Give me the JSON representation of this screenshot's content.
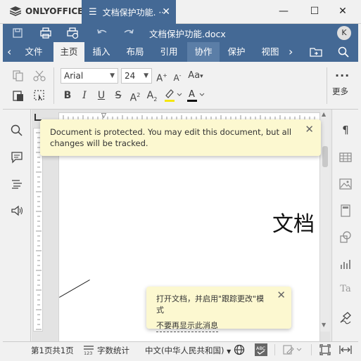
{
  "app": {
    "name": "ONLYOFFICE"
  },
  "window": {
    "tab_title": "文档保护功能.",
    "tab_ellipsis": "···"
  },
  "header": {
    "doc_title": "文档保护功能.docx",
    "avatar": "K"
  },
  "tabs": [
    {
      "label": "文件"
    },
    {
      "label": "主页"
    },
    {
      "label": "插入"
    },
    {
      "label": "布局"
    },
    {
      "label": "引用"
    },
    {
      "label": "协作"
    },
    {
      "label": "保护"
    },
    {
      "label": "视图"
    }
  ],
  "toolbar": {
    "font_name": "Arial",
    "font_size": "24",
    "more_label": "更多"
  },
  "document": {
    "visible_text": "文档"
  },
  "notification_protected": {
    "text": "Document is protected. You may edit this document, but all changes will be tracked."
  },
  "notification_track": {
    "text": "打开文档，并启用\"跟踪更改\"模式",
    "link": "不要再显示此消息"
  },
  "statusbar": {
    "page_info": "第1页共1页",
    "word_count": "字数统计",
    "language": "中文(中华人民共和国)"
  },
  "colors": {
    "brand_blue": "#446995",
    "highlight_yellow": "#f5e60b",
    "note_bg": "#fcf8d0"
  }
}
